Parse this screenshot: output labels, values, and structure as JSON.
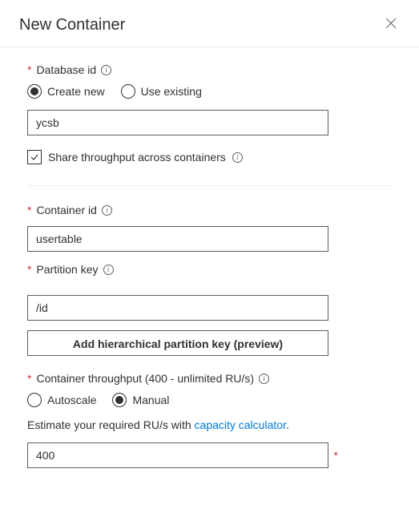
{
  "header": {
    "title": "New Container"
  },
  "database": {
    "label": "Database id",
    "radio_create_new": "Create new",
    "radio_use_existing": "Use existing",
    "value": "ycsb",
    "share_throughput_label": "Share throughput across containers"
  },
  "container": {
    "label": "Container id",
    "value": "usertable"
  },
  "partition": {
    "label": "Partition key",
    "value": "/id",
    "hierarchical_button": "Add hierarchical partition key (preview)"
  },
  "throughput": {
    "label": "Container throughput (400 - unlimited RU/s)",
    "radio_autoscale": "Autoscale",
    "radio_manual": "Manual",
    "estimate_prefix": "Estimate your required RU/s with ",
    "estimate_link": "capacity calculator",
    "estimate_suffix": ".",
    "value": "400"
  }
}
